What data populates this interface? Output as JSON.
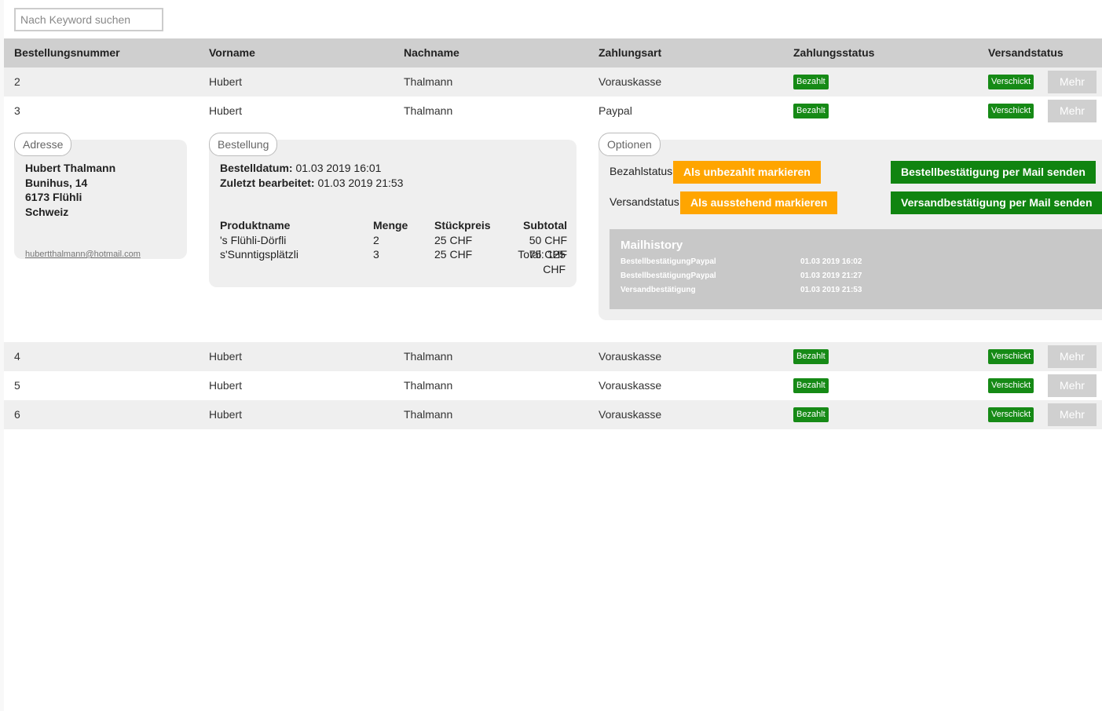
{
  "search": {
    "placeholder": "Nach Keyword suchen"
  },
  "columns": [
    "Bestellungsnummer",
    "Vorname",
    "Nachname",
    "Zahlungsart",
    "Zahlungsstatus",
    "Versandstatus"
  ],
  "rows": [
    {
      "nr": "2",
      "vorname": "Hubert",
      "nachname": "Thalmann",
      "zahlungsart": "Vorauskasse",
      "zahlungsstatus": "Bezahlt",
      "versandstatus": "Verschickt",
      "more": "Mehr"
    },
    {
      "nr": "3",
      "vorname": "Hubert",
      "nachname": "Thalmann",
      "zahlungsart": "Paypal",
      "zahlungsstatus": "Bezahlt",
      "versandstatus": "Verschickt",
      "more": "Mehr"
    },
    {
      "nr": "4",
      "vorname": "Hubert",
      "nachname": "Thalmann",
      "zahlungsart": "Vorauskasse",
      "zahlungsstatus": "Bezahlt",
      "versandstatus": "Verschickt",
      "more": "Mehr"
    },
    {
      "nr": "5",
      "vorname": "Hubert",
      "nachname": "Thalmann",
      "zahlungsart": "Vorauskasse",
      "zahlungsstatus": "Bezahlt",
      "versandstatus": "Verschickt",
      "more": "Mehr"
    },
    {
      "nr": "6",
      "vorname": "Hubert",
      "nachname": "Thalmann",
      "zahlungsart": "Vorauskasse",
      "zahlungsstatus": "Bezahlt",
      "versandstatus": "Verschickt",
      "more": "Mehr"
    }
  ],
  "detail": {
    "address": {
      "legend": "Adresse",
      "name": "Hubert Thalmann",
      "street": "Bunihus, 14",
      "city": "6173 Flühli",
      "country": "Schweiz",
      "email": "hubertthalmann@hotmail.com"
    },
    "order": {
      "legend": "Bestellung",
      "date_label": "Bestelldatum:",
      "date_value": "01.03 2019 16:01",
      "edited_label": "Zuletzt bearbeitet:",
      "edited_value": "01.03 2019 21:53",
      "headers": [
        "Produktname",
        "Menge",
        "Stückpreis",
        "Subtotal"
      ],
      "items": [
        {
          "name": "'s Flühli-Dörfli",
          "qty": "2",
          "price": "25 CHF",
          "subtotal": "50 CHF"
        },
        {
          "name": "s'Sunntigsplätzli",
          "qty": "3",
          "price": "25 CHF",
          "subtotal": "75 CHF"
        }
      ],
      "total_line1": "Total: 125",
      "total_line2": "CHF"
    },
    "options": {
      "legend": "Optionen",
      "pay_label": "Bezahlstatus",
      "pay_button": "Als unbezahlt markieren",
      "ship_label": "Versandstatus",
      "ship_button": "Als ausstehend markieren",
      "order_mail_button": "Bestellbestätigung per Mail senden",
      "ship_mail_button": "Versandbestätigung per Mail senden",
      "mailhistory": {
        "title": "Mailhistory",
        "entries": [
          {
            "type": "BestellbestätigungPaypal",
            "date": "01.03 2019 16:02"
          },
          {
            "type": "BestellbestätigungPaypal",
            "date": "01.03 2019 21:27"
          },
          {
            "type": "Versandbestätigung",
            "date": "01.03 2019 21:53"
          }
        ]
      }
    }
  },
  "colors": {
    "badge": "#168a16",
    "orange": "#ffa500",
    "green": "#108410",
    "header": "#cfcfcf"
  }
}
